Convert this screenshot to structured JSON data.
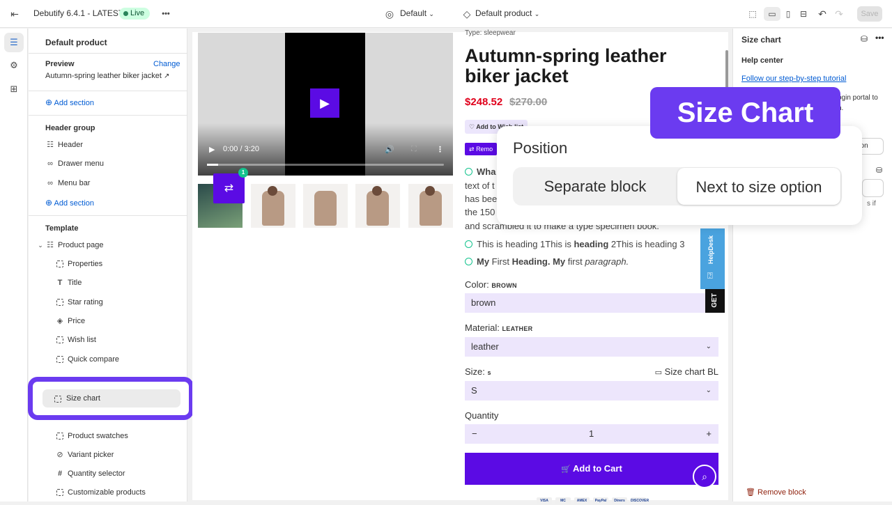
{
  "topbar": {
    "theme_name": "Debutify 6.4.1 - LATEST",
    "live_label": "Live",
    "more": "•••",
    "center_select": "Default",
    "template_select": "Default product",
    "save_label": "Save"
  },
  "sidebar": {
    "title": "Default product",
    "preview_label": "Preview",
    "change_label": "Change",
    "preview_value": "Autumn-spring leather biker jacket",
    "add_section_1": "Add section",
    "header_group_title": "Header group",
    "header_items": [
      "Header",
      "Drawer menu",
      "Menu bar"
    ],
    "add_section_2": "Add section",
    "template_title": "Template",
    "product_page": "Product page",
    "blocks": [
      "Properties",
      "Title",
      "Star rating",
      "Price",
      "Wish list",
      "Quick compare",
      "Size chart",
      "Product swatches",
      "Variant picker",
      "Quantity selector",
      "Customizable products"
    ]
  },
  "preview": {
    "video_time": "0:00 / 3:20",
    "compare_count": "1",
    "product_type": "Type: sleepwear",
    "product_title": "Autumn-spring leather biker jacket",
    "price": "$248.52",
    "price_old": "$270.00",
    "wish_label": "Add to Wish list",
    "remove_label": "Remo",
    "desc_line1_bold": "Wha",
    "desc_lines": [
      "text of t",
      "has bee",
      "the 150",
      "and scrambled it to make a type specimen book."
    ],
    "heading_line1": "This is heading 1This is ",
    "heading_line1_bold": "heading",
    "heading_line1_end": " 2This is heading 3",
    "heading_line2_a": "My",
    "heading_line2_b": " First ",
    "heading_line2_c": "Heading. My",
    "heading_line2_d": " first ",
    "heading_line2_e": "paragraph.",
    "color_label": "Color:",
    "color_value_small": "BROWN",
    "color_value": "brown",
    "material_label": "Material:",
    "material_value_small": "LEATHER",
    "material_value": "leather",
    "size_label": "Size:",
    "size_value_small": "s",
    "size_chart_link": "Size chart BL",
    "size_value": "S",
    "quantity_label": "Quantity",
    "quantity_minus": "−",
    "quantity_value": "1",
    "quantity_plus": "+",
    "add_to_cart": "Add to Cart",
    "helpdesk": "HelpDesk",
    "get": "GET",
    "payments": [
      "VISA",
      "MC",
      "AMEX",
      "PayPal",
      "Diners",
      "DISCOVER"
    ]
  },
  "rpanel": {
    "title": "Size chart",
    "help_center": "Help center",
    "tutorial_link": "Follow our step-by-step tutorial",
    "portal_text_1": "ogin portal to",
    "portal_text_2": "n.",
    "option_btn": "ption",
    "small_text": "s if",
    "remove_block": "Remove block"
  },
  "overlay": {
    "title": "Size Chart",
    "position_label": "Position",
    "options": [
      "Separate block",
      "Next to size option"
    ],
    "selected": "Next to size option"
  }
}
